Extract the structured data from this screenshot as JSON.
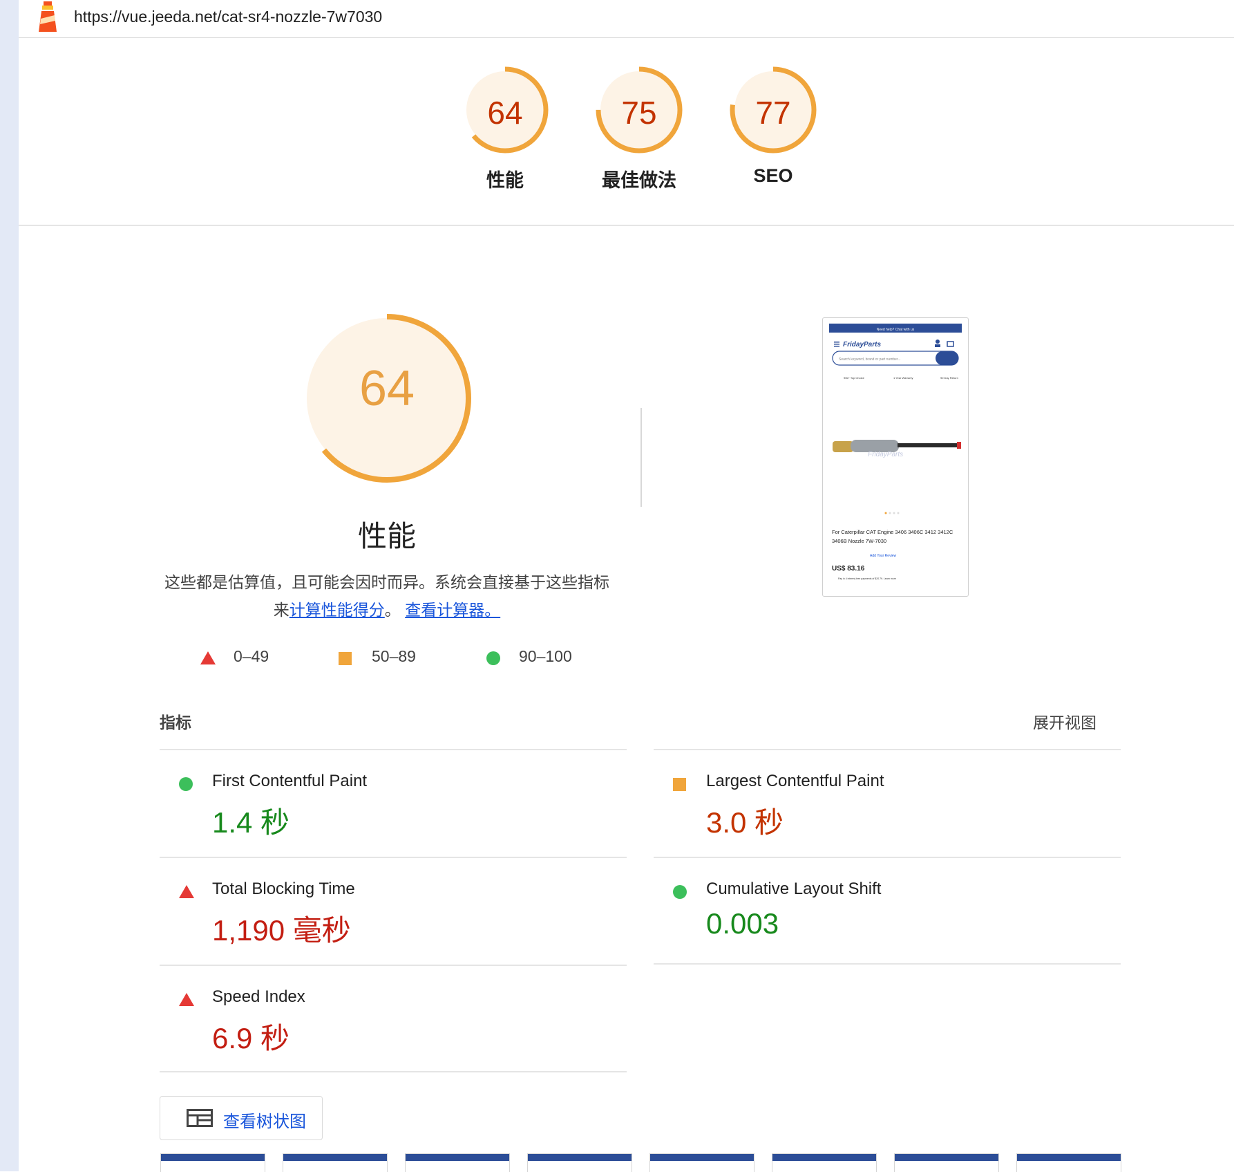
{
  "url": "https://vue.jeeda.net/cat-sr4-nozzle-7w7030",
  "gauges": [
    {
      "score": "64",
      "label": "性能",
      "fraction": 0.64
    },
    {
      "score": "75",
      "label": "最佳做法",
      "fraction": 0.75
    },
    {
      "score": "77",
      "label": "SEO",
      "fraction": 0.77
    }
  ],
  "performance": {
    "score": "64",
    "fraction": 0.64,
    "title": "性能",
    "description_prefix": "这些都是估算值，且可能会因时而异。系统会直接基于这些指标来",
    "link1": "计算性能得分",
    "mid": "。",
    "link2": "查看计算器。"
  },
  "legend": {
    "fail": "0–49",
    "average": "50–89",
    "pass": "90–100"
  },
  "metrics_section": {
    "title": "指标",
    "expand_label": "展开视图"
  },
  "metrics": [
    {
      "label": "First Contentful Paint",
      "value": "1.4 秒",
      "rating": "pass"
    },
    {
      "label": "Largest Contentful Paint",
      "value": "3.0 秒",
      "rating": "average"
    },
    {
      "label": "Total Blocking Time",
      "value": "1,190 毫秒",
      "rating": "fail"
    },
    {
      "label": "Cumulative Layout Shift",
      "value": "0.003",
      "rating": "pass"
    },
    {
      "label": "Speed Index",
      "value": "6.9 秒",
      "rating": "fail"
    }
  ],
  "treemap_button": "查看树状图",
  "preview": {
    "help_text": "Need help? Chat with us",
    "brand": "FridayParts",
    "search_placeholder": "Search keyword, brand or part number...",
    "features": [
      "90k+ Top Choice",
      "1 Year Warranty",
      "90 Day Return"
    ],
    "product_title": "For Caterpillar CAT Engine 3406 3406C 3412 3412C 3406B Nozzle 7W-7030",
    "review_link": "Add Your Review",
    "price": "US$ 83.16",
    "paypal_text": "Pay in 4 interest-free payments of $20.79. Learn more"
  },
  "colors": {
    "orange_arc": "#f0a53b",
    "gauge_bg": "#fdf3e6",
    "score_text": "#c33300",
    "big_score_text": "#e8a043",
    "pass": "#3cbf5b",
    "average": "#f0a53b",
    "fail": "#e53935",
    "link": "#1a56db",
    "thumb_bar": "#2c4d97"
  }
}
